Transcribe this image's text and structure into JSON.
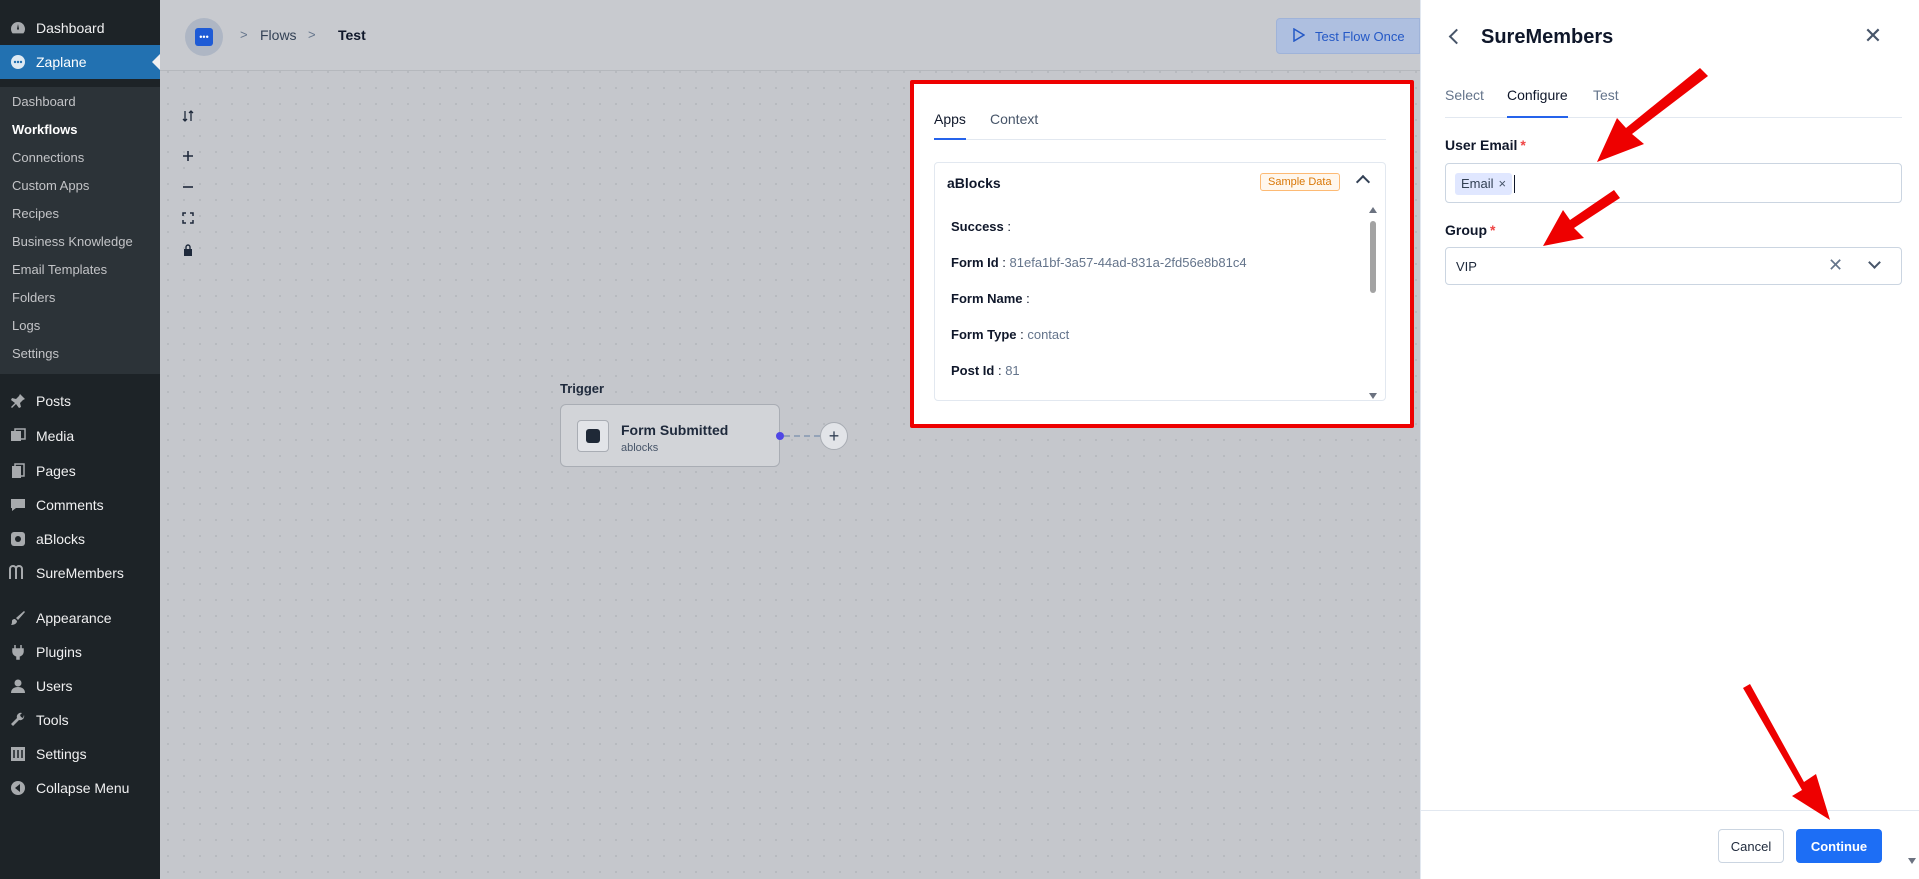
{
  "wp_menu": {
    "top": [
      {
        "label": "Dashboard",
        "icon": "dashboard-icon"
      },
      {
        "label": "Zaplane",
        "icon": "zaplane-icon"
      }
    ],
    "zaplane_sub": [
      "Dashboard",
      "Workflows",
      "Connections",
      "Custom Apps",
      "Recipes",
      "Business Knowledge",
      "Email Templates",
      "Folders",
      "Logs",
      "Settings"
    ],
    "bottom": [
      {
        "label": "Posts",
        "icon": "pin-icon"
      },
      {
        "label": "Media",
        "icon": "media-icon"
      },
      {
        "label": "Pages",
        "icon": "pages-icon"
      },
      {
        "label": "Comments",
        "icon": "comment-icon"
      },
      {
        "label": "aBlocks",
        "icon": "ablocks-icon"
      },
      {
        "label": "SureMembers",
        "icon": "suremembers-icon"
      },
      {
        "label": "Appearance",
        "icon": "brush-icon"
      },
      {
        "label": "Plugins",
        "icon": "plug-icon"
      },
      {
        "label": "Users",
        "icon": "user-icon"
      },
      {
        "label": "Tools",
        "icon": "wrench-icon"
      },
      {
        "label": "Settings",
        "icon": "settings-icon"
      },
      {
        "label": "Collapse Menu",
        "icon": "collapse-icon"
      }
    ]
  },
  "breadcrumb": {
    "flows": "Flows",
    "current": "Test",
    "sep": ">"
  },
  "toolbar": {
    "test_flow": "Test Flow Once"
  },
  "canvas": {
    "trigger_label": "Trigger",
    "trigger_title": "Form Submitted",
    "trigger_app": "ablocks",
    "add": "+"
  },
  "popup": {
    "tabs": [
      "Apps",
      "Context"
    ],
    "app_name": "aBlocks",
    "badge": "Sample Data",
    "fields": [
      {
        "key": "Success",
        "value": ""
      },
      {
        "key": "Form Id",
        "value": "81efa1bf-3a57-44ad-831a-2fd56e8b81c4"
      },
      {
        "key": "Form Name",
        "value": ""
      },
      {
        "key": "Form Type",
        "value": "contact"
      },
      {
        "key": "Post Id",
        "value": "81"
      }
    ]
  },
  "panel": {
    "title": "SureMembers",
    "close": "✕",
    "tabs": [
      "Select",
      "Configure",
      "Test"
    ],
    "user_email_label": "User Email",
    "required_mark": "*",
    "email_chip": "Email",
    "chip_remove": "×",
    "group_label": "Group",
    "group_value": "VIP",
    "group_clear": "✕",
    "cancel": "Cancel",
    "continue": "Continue"
  },
  "colors": {
    "accent": "#2563eb",
    "annotation": "#ee0000",
    "wp_active": "#2271b1"
  }
}
